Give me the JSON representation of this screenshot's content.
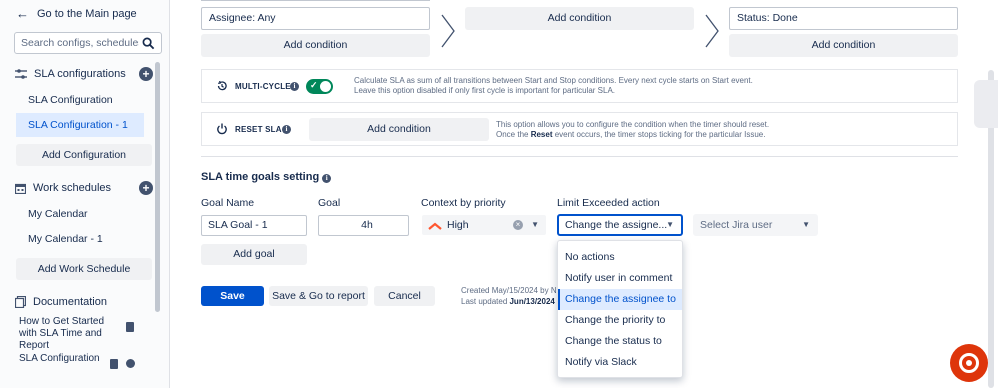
{
  "sidebar": {
    "back_label": "Go to the Main page",
    "search_placeholder": "Search configs, schedules",
    "sla_section": "SLA configurations",
    "sla_items": [
      "SLA Configuration",
      "SLA Configuration - 1"
    ],
    "add_configuration": "Add Configuration",
    "work_section": "Work schedules",
    "work_items": [
      "My Calendar",
      "My Calendar - 1"
    ],
    "add_work_schedule": "Add Work Schedule",
    "docs_section": "Documentation",
    "docs": [
      "How to Get Started with SLA Time and Report",
      "SLA Configuration Tutorial"
    ]
  },
  "conditions": {
    "start_field": "Assignee: Any",
    "stop_field": "Status: Done",
    "add_condition": "Add condition"
  },
  "multicycle": {
    "title": "MULTI-CYCLE",
    "enabled": true,
    "desc1": "Calculate SLA as sum of all transitions between Start and Stop conditions. Every next cycle starts on Start event.",
    "desc2": "Leave this option disabled if only first cycle is important for particular SLA."
  },
  "reset": {
    "title": "RESET SLA",
    "add_condition": "Add condition",
    "desc1": "This option allows you to configure the condition when the timer should reset.",
    "desc2_pre": "Once the ",
    "desc2_bold": "Reset",
    "desc2_post": " event occurs, the timer stops ticking for the particular Issue."
  },
  "goals": {
    "heading": "SLA time goals setting",
    "col_name": "Goal Name",
    "col_goal": "Goal",
    "col_priority": "Context by priority",
    "col_action": "Limit Exceeded action",
    "goal_name": "SLA Goal - 1",
    "goal_value": "4h",
    "priority": "High",
    "action": "Change the assigne...",
    "user_placeholder": "Select Jira user",
    "add_goal": "Add goal"
  },
  "menu": {
    "items": [
      "No actions",
      "Notify user in comment",
      "Change the assignee to",
      "Change the priority to",
      "Change the status to",
      "Notify via Slack"
    ],
    "selected_index": 2
  },
  "actions": {
    "save": "Save",
    "save_report": "Save & Go to report",
    "cancel": "Cancel"
  },
  "meta": {
    "created_label": "Created ",
    "created": "May/15/2024",
    "created_by": " by N",
    "updated_label": "Last updated ",
    "updated": "Jun/13/2024"
  },
  "colors": {
    "primary": "#0052cc",
    "toggle_on": "#00875a",
    "help": "#de350b",
    "priority_high": "#ff5630"
  }
}
